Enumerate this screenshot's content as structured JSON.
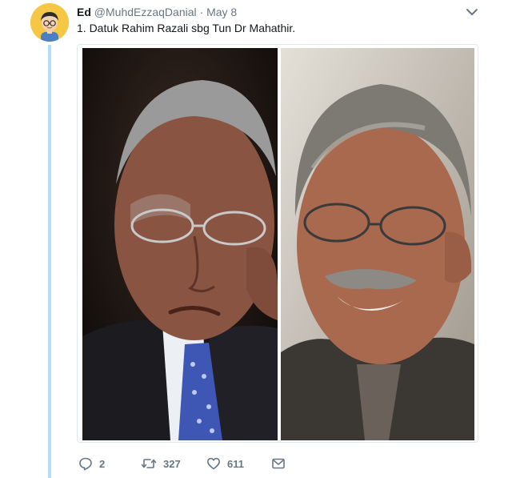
{
  "tweet": {
    "author_name": "Ed",
    "author_handle": "@MuhdEzzaqDanial",
    "separator": "·",
    "date": "May 8",
    "text": "1. Datuk Rahim Razali sbg Tun Dr Mahathir."
  },
  "actions": {
    "reply_count": "2",
    "retweet_count": "327",
    "like_count": "611"
  },
  "colors": {
    "thread_line": "#b3def8",
    "muted_text": "#657786",
    "avatar_background": "#f6c744"
  },
  "icons": [
    "avatar-icon",
    "chevron-down-icon",
    "reply-icon",
    "retweet-icon",
    "like-icon",
    "direct-message-icon"
  ]
}
